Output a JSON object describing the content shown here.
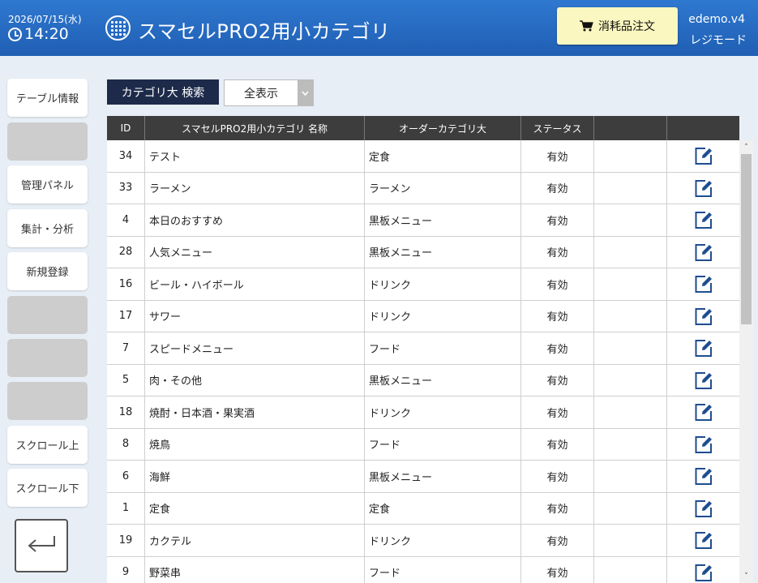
{
  "header": {
    "date": "2026/07/15(水)",
    "time": "14:20",
    "title": "スマセルPRO2用小カテゴリ",
    "order_button": "消耗品注文",
    "version": "edemo.v4",
    "mode": "レジモード",
    "icons": [
      "clock-icon",
      "app-grid-icon",
      "cart-icon"
    ]
  },
  "sidebar": {
    "items": [
      {
        "label": "テーブル情報"
      },
      {
        "label": ""
      },
      {
        "label": "管理パネル"
      },
      {
        "label": "集計・分析"
      },
      {
        "label": "新規登録"
      },
      {
        "label": ""
      },
      {
        "label": ""
      },
      {
        "label": ""
      },
      {
        "label": "スクロール上"
      },
      {
        "label": "スクロール下"
      }
    ],
    "back_icon": "return-arrow-icon"
  },
  "search": {
    "label": "カテゴリ大 検索",
    "selected": "全表示"
  },
  "table": {
    "columns": [
      "ID",
      "スマセルPRO2用小カテゴリ 名称",
      "オーダーカテゴリ大",
      "ステータス",
      "",
      ""
    ],
    "rows": [
      {
        "id": "34",
        "name": "テスト",
        "order": "定食",
        "status": "有効"
      },
      {
        "id": "33",
        "name": "ラーメン",
        "order": "ラーメン",
        "status": "有効"
      },
      {
        "id": "4",
        "name": "本日のおすすめ",
        "order": "黒板メニュー",
        "status": "有効"
      },
      {
        "id": "28",
        "name": "人気メニュー",
        "order": "黒板メニュー",
        "status": "有効"
      },
      {
        "id": "16",
        "name": "ビール・ハイボール",
        "order": "ドリンク",
        "status": "有効"
      },
      {
        "id": "17",
        "name": "サワー",
        "order": "ドリンク",
        "status": "有効"
      },
      {
        "id": "7",
        "name": "スピードメニュー",
        "order": "フード",
        "status": "有効"
      },
      {
        "id": "5",
        "name": "肉・その他",
        "order": "黒板メニュー",
        "status": "有効"
      },
      {
        "id": "18",
        "name": "焼酎・日本酒・果実酒",
        "order": "ドリンク",
        "status": "有効"
      },
      {
        "id": "8",
        "name": "焼鳥",
        "order": "フード",
        "status": "有効"
      },
      {
        "id": "6",
        "name": "海鮮",
        "order": "黒板メニュー",
        "status": "有効"
      },
      {
        "id": "1",
        "name": "定食",
        "order": "定食",
        "status": "有効"
      },
      {
        "id": "19",
        "name": "カクテル",
        "order": "ドリンク",
        "status": "有効"
      },
      {
        "id": "9",
        "name": "野菜串",
        "order": "フード",
        "status": "有効"
      }
    ],
    "edit_icon": "edit-icon"
  },
  "colors": {
    "header_bg": "#2a6fc8",
    "order_button_bg": "#fbf7c0",
    "search_label_bg": "#1d2a4a",
    "table_header_bg": "#3d3d3d",
    "edit_icon": "#1f4d8f"
  }
}
